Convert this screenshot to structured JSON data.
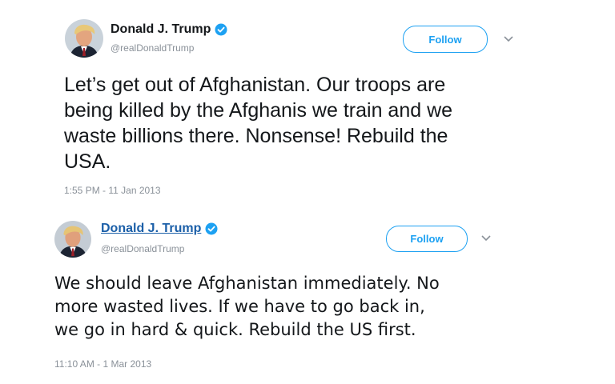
{
  "tweets": [
    {
      "display_name": "Donald J. Trump",
      "handle": "@realDonaldTrump",
      "follow_label": "Follow",
      "text": "Let’s get out of Afghanistan. Our troops are\nbeing killed by the Afghanis we train and we\nwaste billions there. Nonsense!  Rebuild the\nUSA.",
      "timestamp": "1:55 PM - 11 Jan 2013"
    },
    {
      "display_name": "Donald J. Trump",
      "handle": "@realDonaldTrump",
      "follow_label": "Follow",
      "text": "We should leave Afghanistan immediately. No\nmore wasted lives. If we have to go back in,\nwe go in hard & quick. Rebuild the US first.",
      "timestamp": "11:10 AM - 1 Mar 2013"
    }
  ],
  "colors": {
    "accent": "#1da1f2",
    "verified": "#1da1f2",
    "secondary_text": "#8a9199",
    "linked_name": "#1b5fa8"
  },
  "icons": {
    "verified": "verified-badge-icon",
    "caret": "chevron-down-icon",
    "avatar": "profile-photo"
  }
}
